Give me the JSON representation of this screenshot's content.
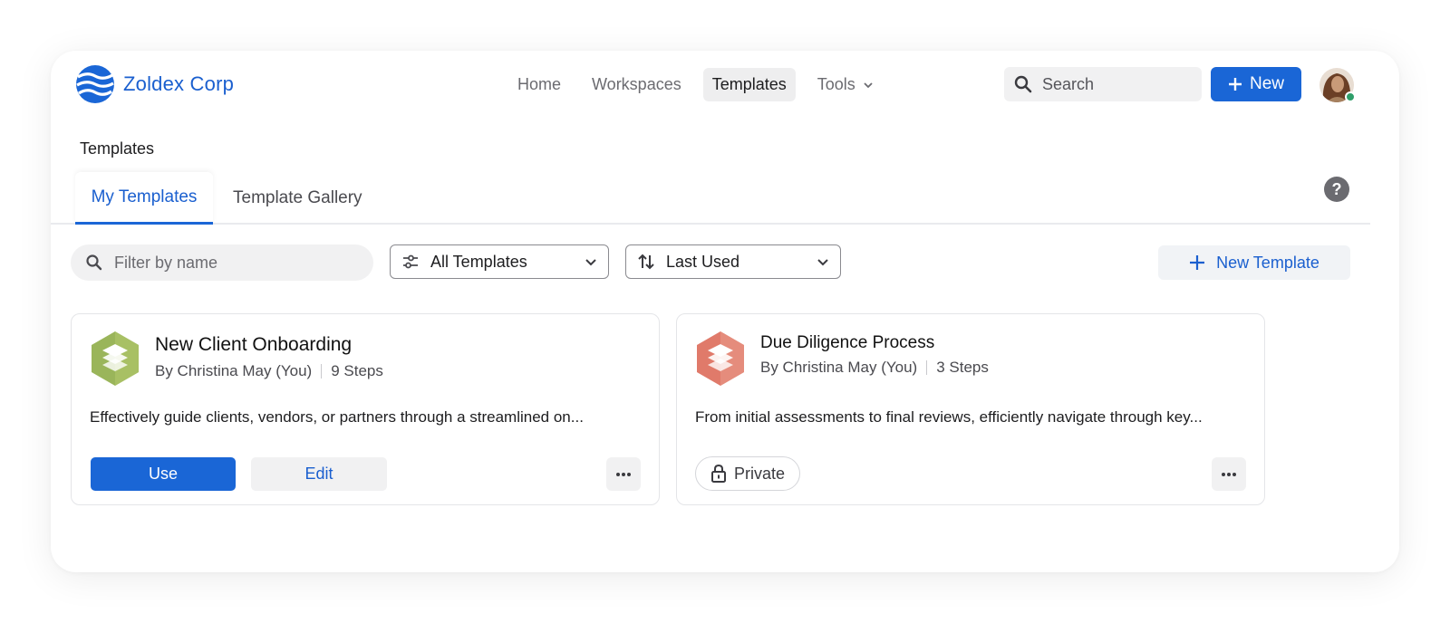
{
  "brand": {
    "name": "Zoldex Corp",
    "color": "#1a5fcf"
  },
  "nav": {
    "items": [
      {
        "label": "Home",
        "active": false
      },
      {
        "label": "Workspaces",
        "active": false
      },
      {
        "label": "Templates",
        "active": true
      },
      {
        "label": "Tools",
        "active": false,
        "has_dropdown": true
      }
    ]
  },
  "header": {
    "search_placeholder": "Search",
    "new_button_label": "New",
    "user_status": "online"
  },
  "page": {
    "title": "Templates",
    "tabs": [
      {
        "label": "My Templates",
        "active": true
      },
      {
        "label": "Template Gallery",
        "active": false
      }
    ]
  },
  "filters": {
    "name_placeholder": "Filter by name",
    "type_selected": "All Templates",
    "sort_selected": "Last Used",
    "new_template_label": "New Template"
  },
  "templates": [
    {
      "title": "New Client Onboarding",
      "author": "By  Christina May (You)",
      "steps": "9 Steps",
      "description": "Effectively guide clients, vendors, or partners through a streamlined on...",
      "icon_color": "#9ab55a",
      "use_label": "Use",
      "edit_label": "Edit"
    },
    {
      "title": "Due Diligence Process",
      "author": "By  Christina May (You)",
      "steps": "3 Steps",
      "description": "From initial assessments to final reviews, efficiently navigate through key...",
      "icon_color": "#e07a6a",
      "visibility_label": "Private"
    }
  ]
}
